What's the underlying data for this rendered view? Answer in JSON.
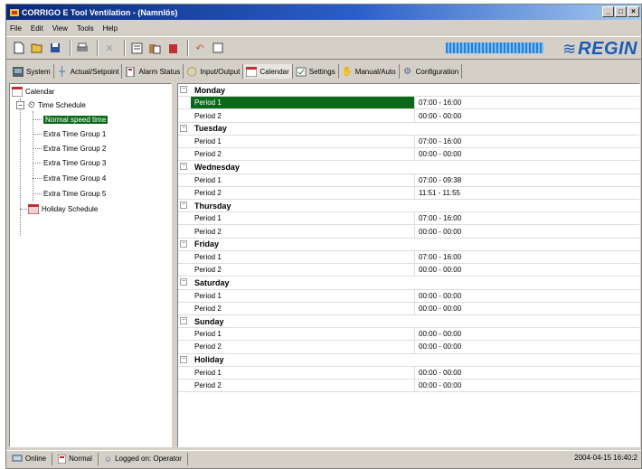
{
  "window": {
    "title": "CORRIGO E Tool Ventilation - (Namnlös)",
    "controls": [
      "minimize",
      "maximize",
      "close"
    ]
  },
  "menu": [
    "File",
    "Edit",
    "View",
    "Tools",
    "Help"
  ],
  "toolbar": {
    "icons": [
      "new-icon",
      "open-icon",
      "save-icon",
      "print-icon",
      "cut-icon",
      "copy-icon",
      "paste-icon",
      "delete-icon",
      "undo-icon",
      "redo-icon"
    ],
    "brand": "REGIN"
  },
  "tabs": [
    {
      "label": "System",
      "icon": "system-icon"
    },
    {
      "label": "Actual/Setpoint",
      "icon": "setpoint-icon"
    },
    {
      "label": "Alarm Status",
      "icon": "alarm-icon"
    },
    {
      "label": "Input/Output",
      "icon": "io-icon"
    },
    {
      "label": "Calendar",
      "icon": "calendar-icon",
      "active": true
    },
    {
      "label": "Settings",
      "icon": "settings-icon"
    },
    {
      "label": "Manual/Auto",
      "icon": "manual-icon"
    },
    {
      "label": "Configuration",
      "icon": "config-icon"
    }
  ],
  "tree": {
    "root": "Calendar",
    "time_schedule": "Time Schedule",
    "items": [
      "Normal speed time",
      "Extra Time Group 1",
      "Extra Time Group 2",
      "Extra Time Group 3",
      "Extra Time Group 4",
      "Extra Time Group 5"
    ],
    "holiday": "Holiday Schedule"
  },
  "schedule": [
    {
      "day": "Monday",
      "periods": [
        {
          "label": "Period 1",
          "value": "07:00 - 16:00"
        },
        {
          "label": "Period 2",
          "value": "00:00 - 00:00"
        }
      ]
    },
    {
      "day": "Tuesday",
      "periods": [
        {
          "label": "Period 1",
          "value": "07:00 - 16:00"
        },
        {
          "label": "Period 2",
          "value": "00:00 - 00:00"
        }
      ]
    },
    {
      "day": "Wednesday",
      "periods": [
        {
          "label": "Period 1",
          "value": "07:00 - 09:38"
        },
        {
          "label": "Period 2",
          "value": "11:51 - 11:55"
        }
      ]
    },
    {
      "day": "Thursday",
      "periods": [
        {
          "label": "Period 1",
          "value": "07:00 - 16:00"
        },
        {
          "label": "Period 2",
          "value": "00:00 - 00:00"
        }
      ]
    },
    {
      "day": "Friday",
      "periods": [
        {
          "label": "Period 1",
          "value": "07:00 - 16:00"
        },
        {
          "label": "Period 2",
          "value": "00:00 - 00:00"
        }
      ]
    },
    {
      "day": "Saturday",
      "periods": [
        {
          "label": "Period 1",
          "value": "00:00 - 00:00"
        },
        {
          "label": "Period 2",
          "value": "00:00 - 00:00"
        }
      ]
    },
    {
      "day": "Sunday",
      "periods": [
        {
          "label": "Period 1",
          "value": "00:00 - 00:00"
        },
        {
          "label": "Period 2",
          "value": "00:00 - 00:00"
        }
      ]
    },
    {
      "day": "Holiday",
      "periods": [
        {
          "label": "Period 1",
          "value": "00:00 - 00:00"
        },
        {
          "label": "Period 2",
          "value": "00:00 - 00:00"
        }
      ]
    }
  ],
  "status": {
    "connection": "Online",
    "mode": "Normal",
    "login": "Logged on: Operator",
    "datetime": "2004-04-15 16:40:2"
  },
  "colors": {
    "selection": "#0a6a1a",
    "title_start": "#0a2a7a",
    "brand": "#1c5bb5"
  }
}
